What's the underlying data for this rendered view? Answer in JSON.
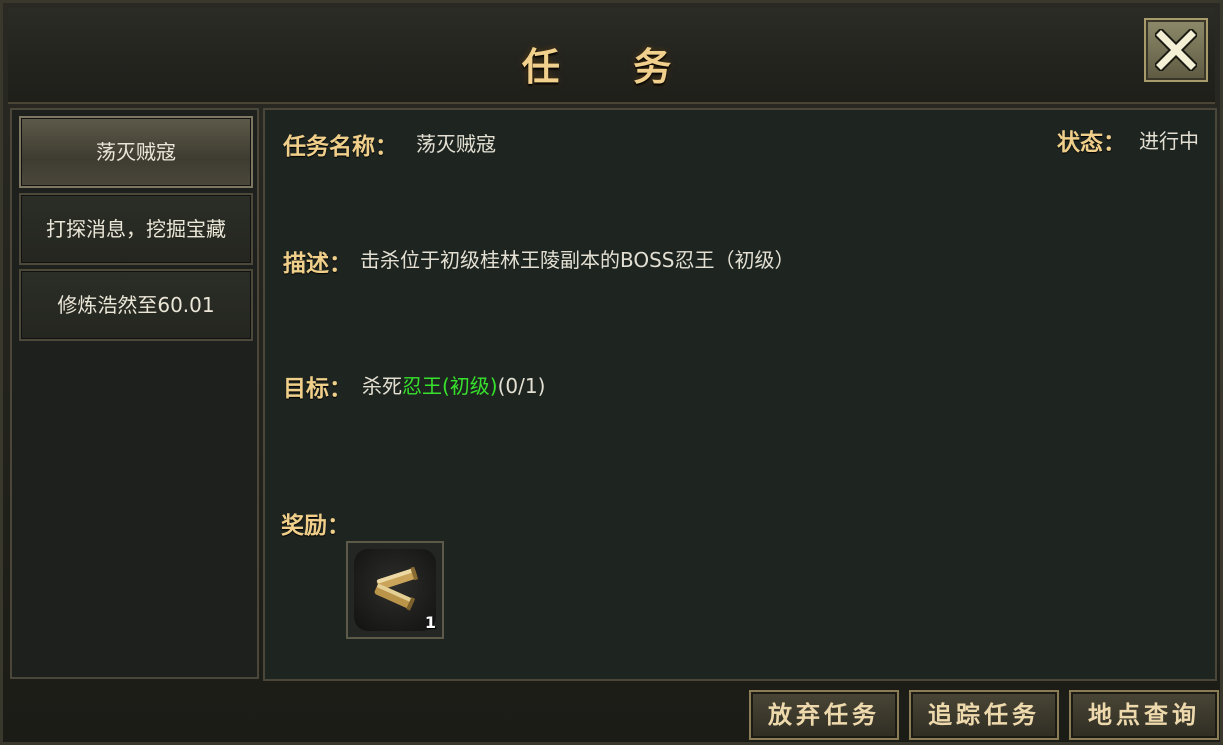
{
  "window": {
    "title": "任 务"
  },
  "quest_list": [
    {
      "label": "荡灭贼寇"
    },
    {
      "label": "打探消息，挖掘宝藏"
    },
    {
      "label": "修炼浩然至60.01"
    }
  ],
  "detail": {
    "name_label": "任务名称：",
    "name_value": "荡灭贼寇",
    "status_label": "状态：",
    "status_value": "进行中",
    "desc_label": "描述：",
    "desc_value": "击杀位于初级桂林王陵副本的BOSS忍王（初级）",
    "target_label": "目标：",
    "target_prefix": "杀死",
    "target_name": "忍王(初级)",
    "target_progress": "(0/1)",
    "reward_label": "奖励：",
    "reward_item": {
      "icon": "bullet-shells-icon",
      "count": "1"
    }
  },
  "footer": {
    "abandon": "放弃任务",
    "track": "追踪任务",
    "location": "地点查询"
  },
  "colors": {
    "gold_label": "#f0cf8a",
    "target_green": "#36e22b"
  }
}
